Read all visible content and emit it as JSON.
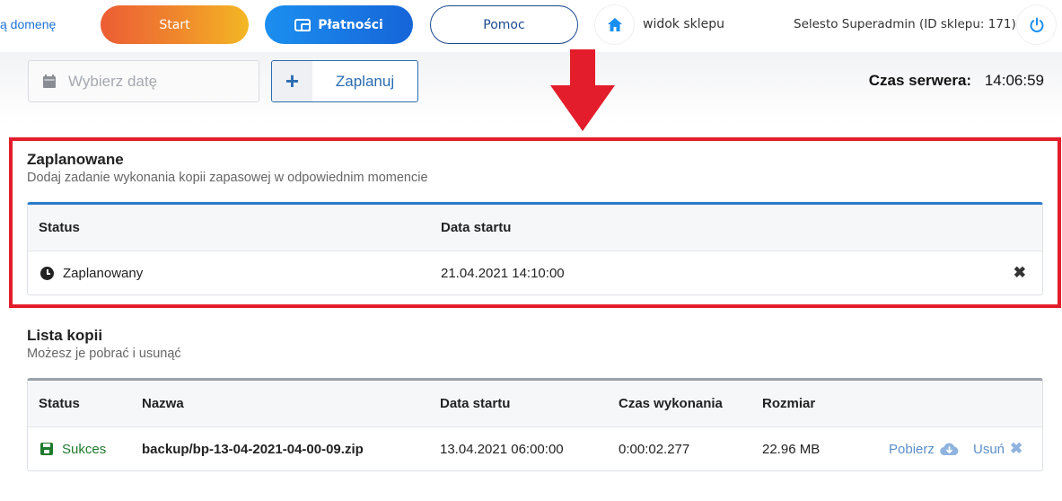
{
  "topbar": {
    "domain_link": "ą domenę",
    "start_label": "Start",
    "payments_label": "Płatności",
    "help_label": "Pomoc",
    "shop_view_label": "widok sklepu",
    "user_info": "Selesto Superadmin (ID sklepu: 171)"
  },
  "toolbar": {
    "date_placeholder": "Wybierz datę",
    "plan_label": "Zaplanuj",
    "server_time_label": "Czas serwera:",
    "server_time_value": "14:06:59"
  },
  "scheduled": {
    "title": "Zaplanowane",
    "subtitle": "Dodaj zadanie wykonania kopii zapasowej w odpowiednim momencie",
    "columns": {
      "status": "Status",
      "start_date": "Data startu"
    },
    "rows": [
      {
        "status": "Zaplanowany",
        "start_date": "21.04.2021 14:10:00"
      }
    ]
  },
  "backups": {
    "title": "Lista kopii",
    "subtitle": "Możesz je pobrać i usunąć",
    "columns": {
      "status": "Status",
      "name": "Nazwa",
      "start_date": "Data startu",
      "duration": "Czas wykonania",
      "size": "Rozmiar"
    },
    "rows": [
      {
        "status": "Sukces",
        "name": "backup/bp-13-04-2021-04-00-09.zip",
        "start_date": "13.04.2021 06:00:00",
        "duration": "0:00:02.277",
        "size": "22.96 MB",
        "download_label": "Pobierz",
        "delete_label": "Usuń"
      }
    ]
  },
  "colors": {
    "highlight": "#e31d2b",
    "primary": "#1b8ff0",
    "success": "#1f7a2c"
  }
}
